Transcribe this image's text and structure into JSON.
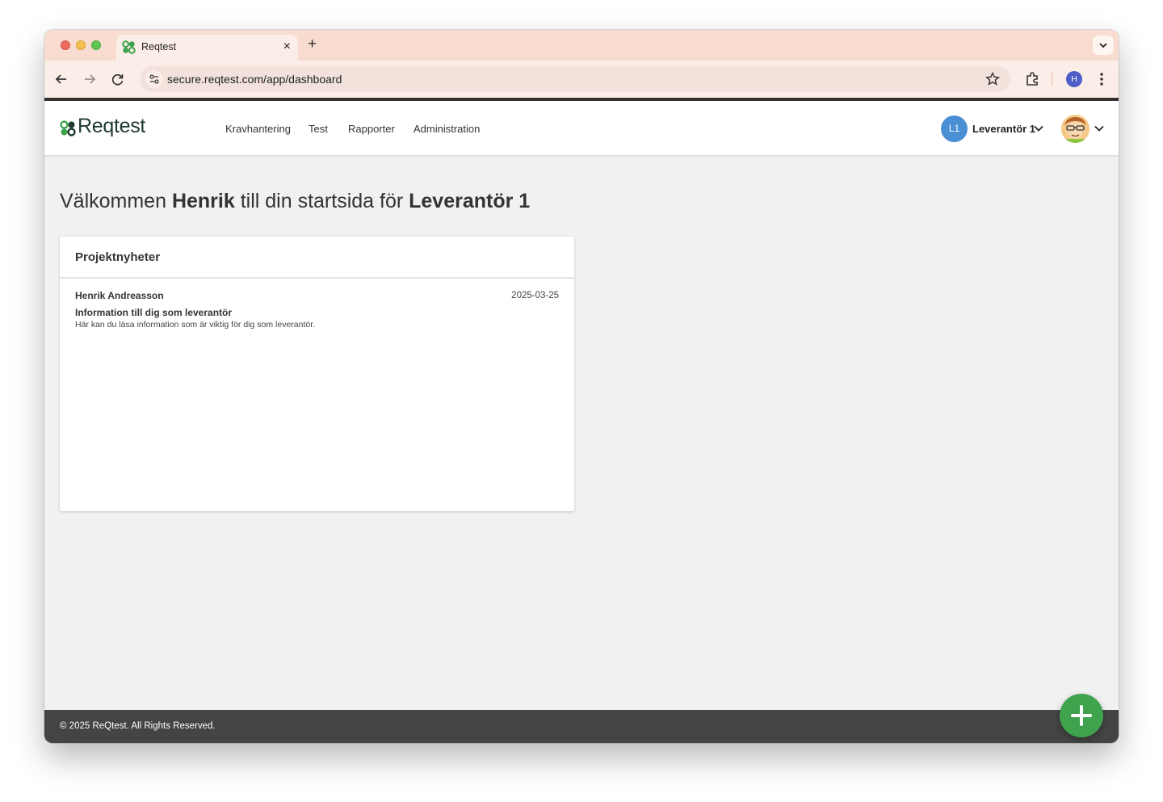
{
  "browser": {
    "tab_title": "Reqtest",
    "new_tab_label": "+",
    "close_label": "×",
    "url": "secure.reqtest.com/app/dashboard",
    "profile_initial": "H"
  },
  "app": {
    "logo_text": "Reqtest",
    "nav": [
      {
        "label": "Kravhantering"
      },
      {
        "label": "Test"
      },
      {
        "label": "Rapporter"
      },
      {
        "label": "Administration"
      }
    ],
    "org": {
      "initials": "L1",
      "name": "Leverantör 1"
    }
  },
  "welcome": {
    "prefix": "Välkommen ",
    "user": "Henrik",
    "middle": " till din startsida för ",
    "org": "Leverantör 1"
  },
  "news_card": {
    "title": "Projektnyheter",
    "items": [
      {
        "author": "Henrik Andreasson",
        "date": "2025-03-25",
        "title": "Information till dig som leverantör",
        "body": "Här kan du läsa information som är viktig för dig som leverantör."
      }
    ]
  },
  "footer": {
    "text": "© 2025 ReQtest. All Rights Reserved."
  },
  "colors": {
    "brand_green": "#3fa34d",
    "org_avatar_blue": "#4a8fd4",
    "footer_bg": "#444444",
    "tabstrip_bg": "#f8dccf"
  },
  "icons": [
    "back-arrow-icon",
    "forward-arrow-icon",
    "reload-icon",
    "site-settings-icon",
    "bookmark-star-icon",
    "extensions-icon",
    "kebab-menu-icon",
    "chevron-down-icon",
    "plus-icon"
  ]
}
